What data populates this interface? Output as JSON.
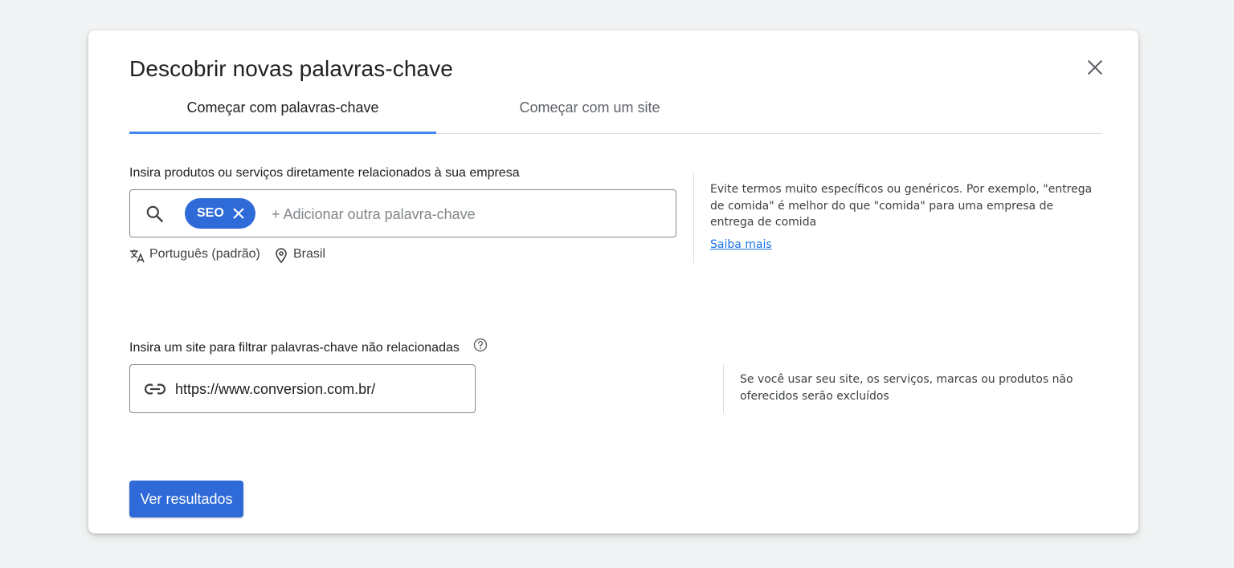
{
  "dialog": {
    "title": "Descobrir novas palavras-chave",
    "close_icon": "close-icon"
  },
  "tabs": [
    {
      "label": "Começar com palavras-chave",
      "active": true
    },
    {
      "label": "Começar com um site",
      "active": false
    }
  ],
  "keywords_section": {
    "label": "Insira produtos ou serviços diretamente relacionados à sua empresa",
    "search_icon": "search-icon",
    "chips": [
      {
        "label": "SEO",
        "remove_icon": "close-icon"
      }
    ],
    "input_placeholder": "+ Adicionar outra palavra-chave",
    "language": {
      "icon": "translate-icon",
      "label": "Português (padrão)"
    },
    "location": {
      "icon": "location-pin-icon",
      "label": "Brasil"
    },
    "hint": "Evite termos muito específicos ou genéricos. Por exemplo, \"entrega de comida\" é melhor do que \"comida\" para uma empresa de entrega de comida",
    "learn_more": "Saiba mais"
  },
  "site_section": {
    "label": "Insira um site para filtrar palavras-chave não relacionadas",
    "help_icon": "help-icon",
    "link_icon": "link-icon",
    "value": "https://www.conversion.com.br/",
    "hint": "Se você usar seu site, os serviços, marcas ou produtos não oferecidos serão excluídos"
  },
  "actions": {
    "submit_label": "Ver resultados"
  },
  "colors": {
    "primary": "#2f6bd8",
    "tab_indicator": "#4285f4",
    "link": "#1a73e8",
    "background": "#f1f3f4"
  }
}
